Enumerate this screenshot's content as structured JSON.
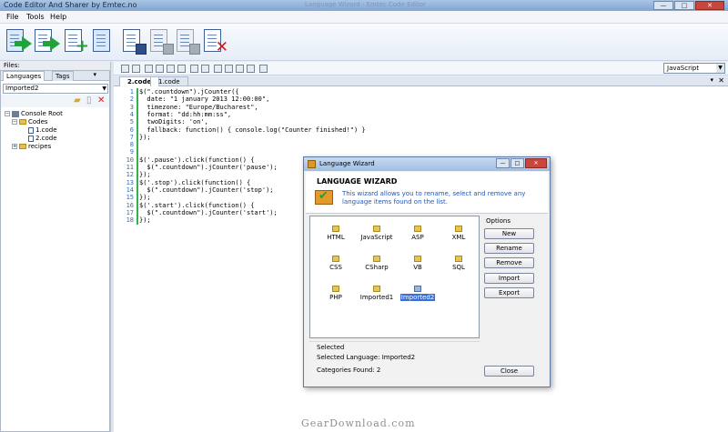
{
  "window": {
    "title": "Code Editor And Sharer by Emtec.no",
    "ghost_title": "Language Wizard - Emtec Code Editor",
    "controls": [
      "—",
      "□",
      "✕"
    ]
  },
  "menu": {
    "items": [
      "File",
      "Tools",
      "Help"
    ]
  },
  "toolbar": {
    "icons": [
      "open-document-icon",
      "export-document-icon",
      "new-document-icon",
      "copy-document-icon",
      "save-icon",
      "save-all-icon",
      "save-as-icon",
      "delete-document-icon"
    ]
  },
  "left_panel": {
    "files_label": "Files:",
    "tabs": [
      "Languages",
      "Tags"
    ],
    "pin": "▾",
    "close": "✕",
    "selected_language": "Imported2",
    "tree": {
      "root": "Console Root",
      "codes": "Codes",
      "files": [
        "1.code",
        "2.code"
      ],
      "recipes": "recipes"
    }
  },
  "editor": {
    "language": "JavaScript",
    "tabs": [
      "2.code",
      "1.code"
    ],
    "pin": "▾",
    "close": "✕",
    "line_numbers": [
      "1",
      "2",
      "3",
      "4",
      "5",
      "6",
      "7",
      "8",
      "9",
      "10",
      "11",
      "12",
      "13",
      "14",
      "15",
      "16",
      "17",
      "18"
    ],
    "code": [
      "$(\".countdown\").jCounter({",
      "  date: \"1 january 2013 12:00:00\",",
      "  timezone: \"Europe/Bucharest\",",
      "  format: \"dd:hh:mm:ss\",",
      "  twoDigits: 'on',",
      "  fallback: function() { console.log(\"Counter finished!\") }",
      "});",
      "",
      "",
      "$('.pause').click(function() {",
      "  $(\".countdown\").jCounter('pause');",
      "});",
      "$('.stop').click(function() {",
      "  $(\".countdown\").jCounter('stop');",
      "});",
      "$('.start').click(function() {",
      "  $(\".countdown\").jCounter('start');",
      "});"
    ]
  },
  "wizard": {
    "title": "Language Wizard",
    "heading": "LANGUAGE WIZARD",
    "description": "This wizard allows you to rename, select and remove any language items found on the list.",
    "languages": [
      "HTML",
      "JavaScript",
      "ASP",
      "XML",
      "CSS",
      "CSharp",
      "VB",
      "SQL",
      "PHP",
      "Imported1",
      "Imported2"
    ],
    "selected_item": "Imported2",
    "options_label": "Options",
    "buttons": {
      "new": "New",
      "rename": "Rename",
      "remove": "Remove",
      "import": "Import",
      "export": "Export",
      "close": "Close"
    },
    "selected_label": "Selected",
    "selected_language_text": "Selected Language: Imported2",
    "categories_found_text": "Categories Found: 2"
  },
  "watermark": "GearDownload.com"
}
